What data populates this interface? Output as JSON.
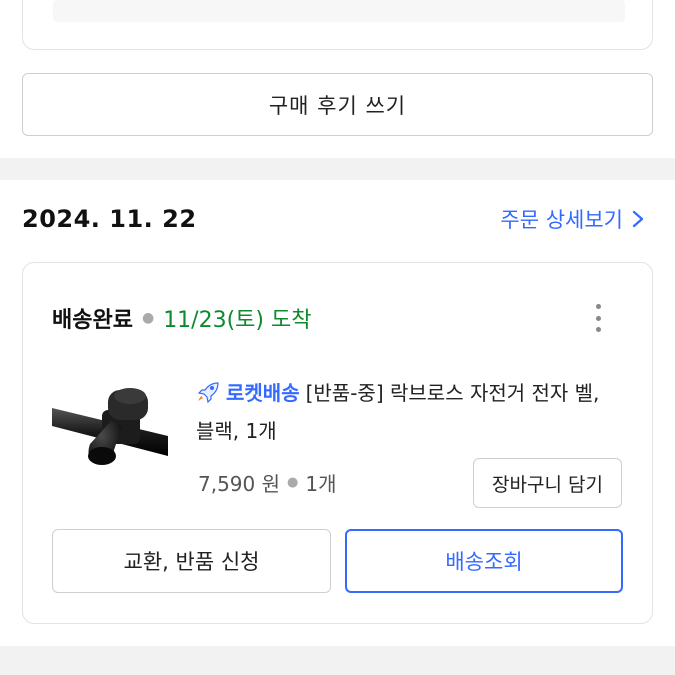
{
  "review": {
    "label": "구매 후기 쓰기"
  },
  "order": {
    "date": "2024. 11. 22",
    "detail_link": "주문 상세보기"
  },
  "shipment": {
    "status": "배송완료",
    "arrival": "11/23(토) 도착"
  },
  "product": {
    "badge_label": "로켓배송",
    "title": "[반품-중] 락브로스 자전거 전자 벨, 블랙, 1개",
    "price": "7,590 원",
    "quantity": "1개"
  },
  "actions": {
    "add_to_cart": "장바구니 담기",
    "exchange_return": "교환, 반품 신청",
    "track_delivery": "배송조회"
  },
  "colors": {
    "accent": "#346aff",
    "delivered_green": "#0c8a2c",
    "band": "#f2f2f2"
  },
  "icons": [
    "chevron-right-icon",
    "more-vertical-icon",
    "rocket-icon"
  ]
}
